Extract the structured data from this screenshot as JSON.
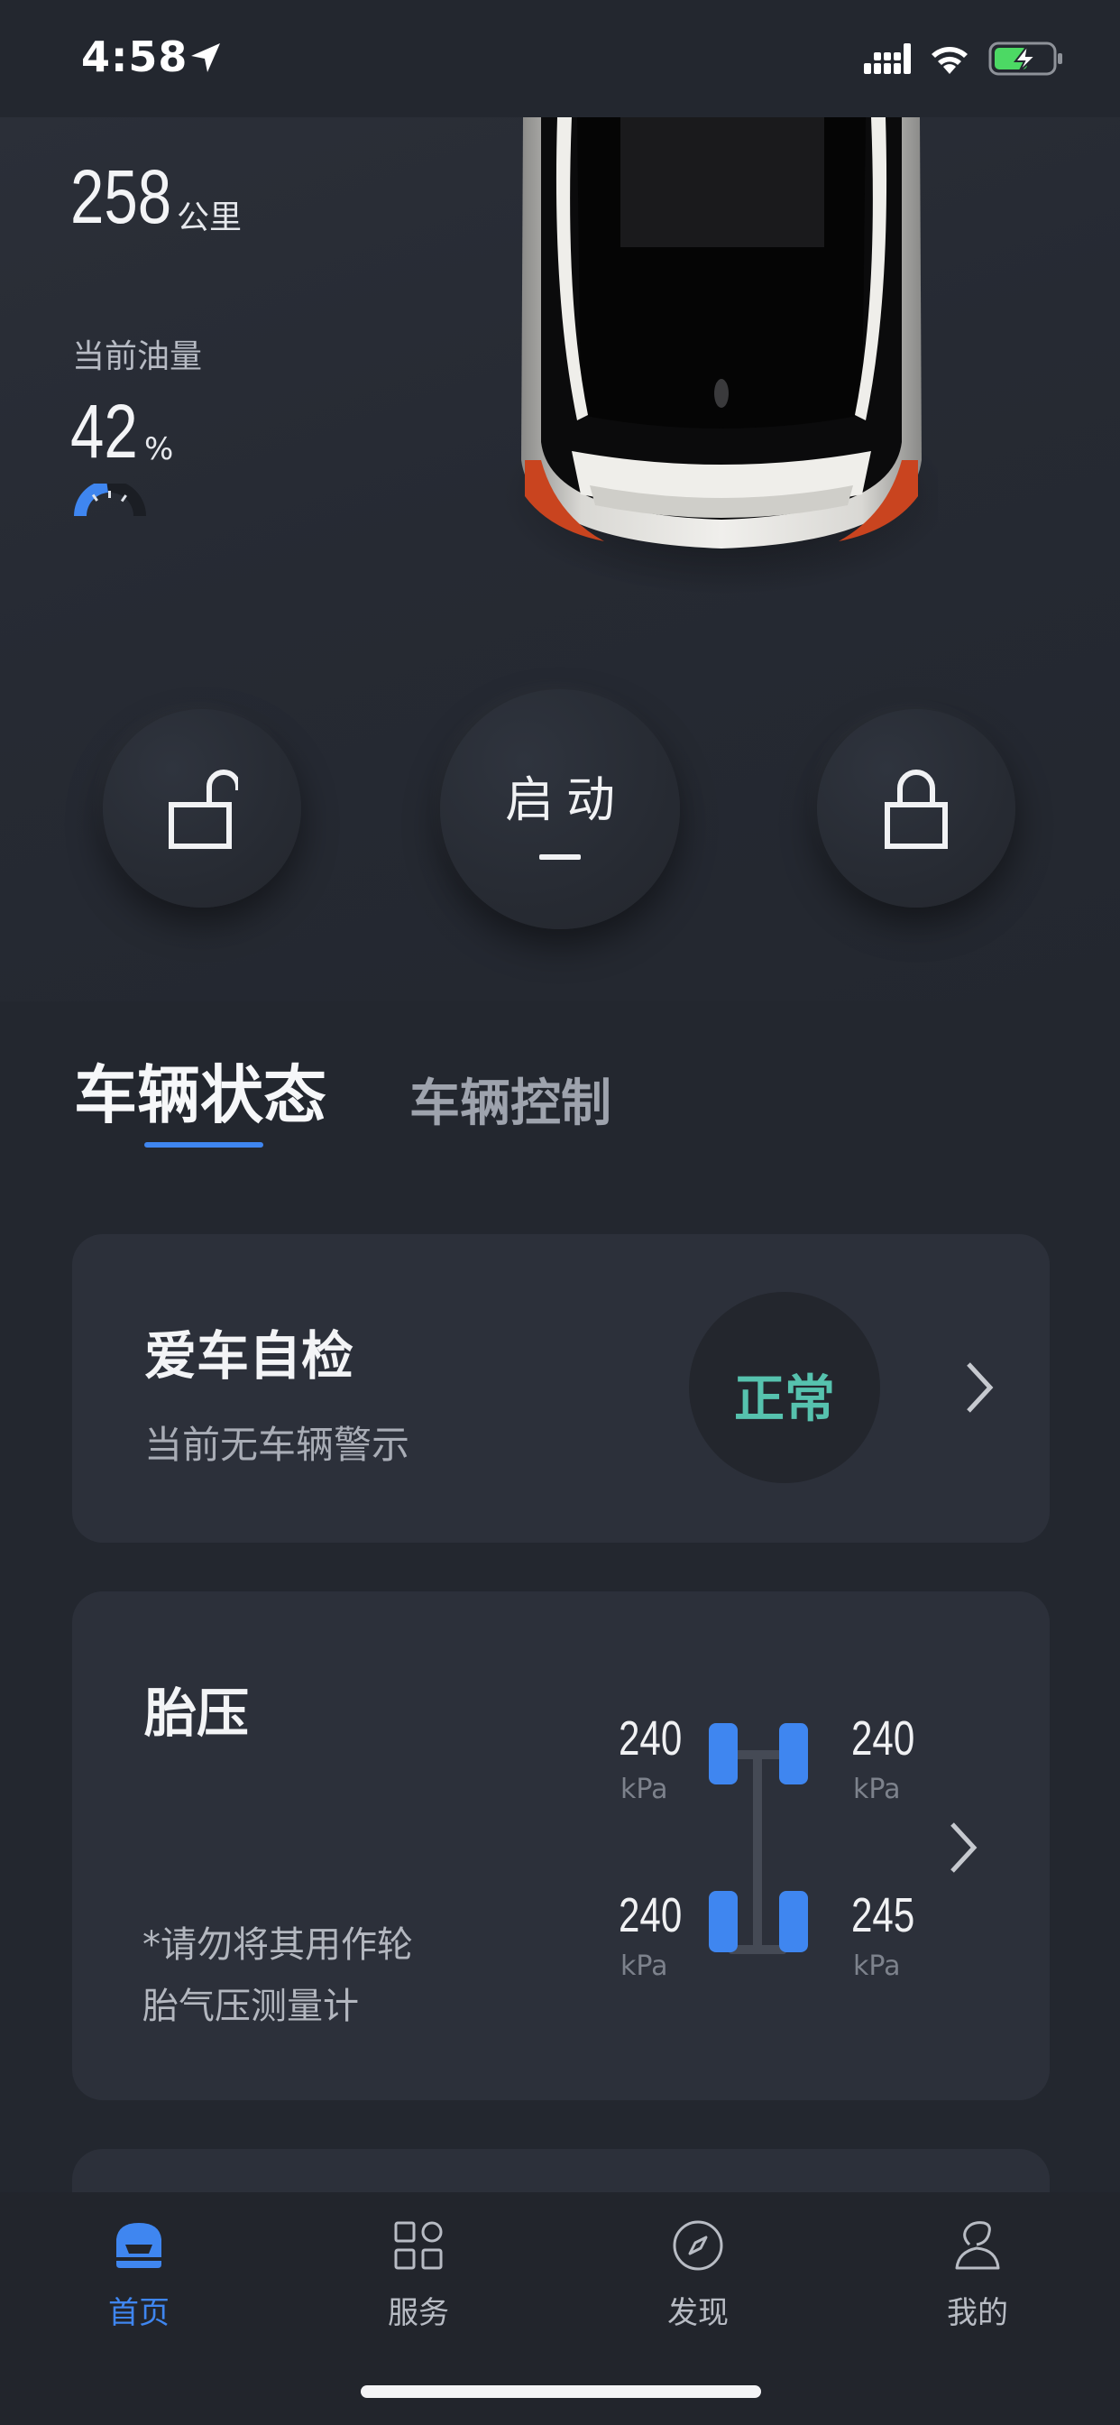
{
  "status_bar": {
    "time": "4:58"
  },
  "vehicle": {
    "range_value": "258",
    "range_unit": "公里",
    "fuel_label": "当前油量",
    "fuel_value": "42",
    "fuel_unit": "%",
    "fuel_level": 0.42
  },
  "controls": {
    "start_label": "启动"
  },
  "tabs": [
    {
      "label": "车辆状态",
      "active": true
    },
    {
      "label": "车辆控制",
      "active": false
    }
  ],
  "self_check": {
    "title": "爱车自检",
    "subtitle": "当前无车辆警示",
    "status": "正常"
  },
  "tire_pressure": {
    "title": "胎压",
    "note_line1": "*请勿将其用作轮",
    "note_line2": "胎气压测量计",
    "front_left": "240",
    "front_right": "240",
    "rear_left": "240",
    "rear_right": "245",
    "unit": "kPa"
  },
  "bottom_nav": [
    {
      "label": "首页",
      "icon": "car-home-icon",
      "active": true
    },
    {
      "label": "服务",
      "icon": "grid-services-icon",
      "active": false
    },
    {
      "label": "发现",
      "icon": "compass-icon",
      "active": false
    },
    {
      "label": "我的",
      "icon": "profile-icon",
      "active": false
    }
  ],
  "colors": {
    "background": "#23272f",
    "card": "#2c303a",
    "accent": "#3f86f0",
    "status_ok": "#56c2ae"
  }
}
